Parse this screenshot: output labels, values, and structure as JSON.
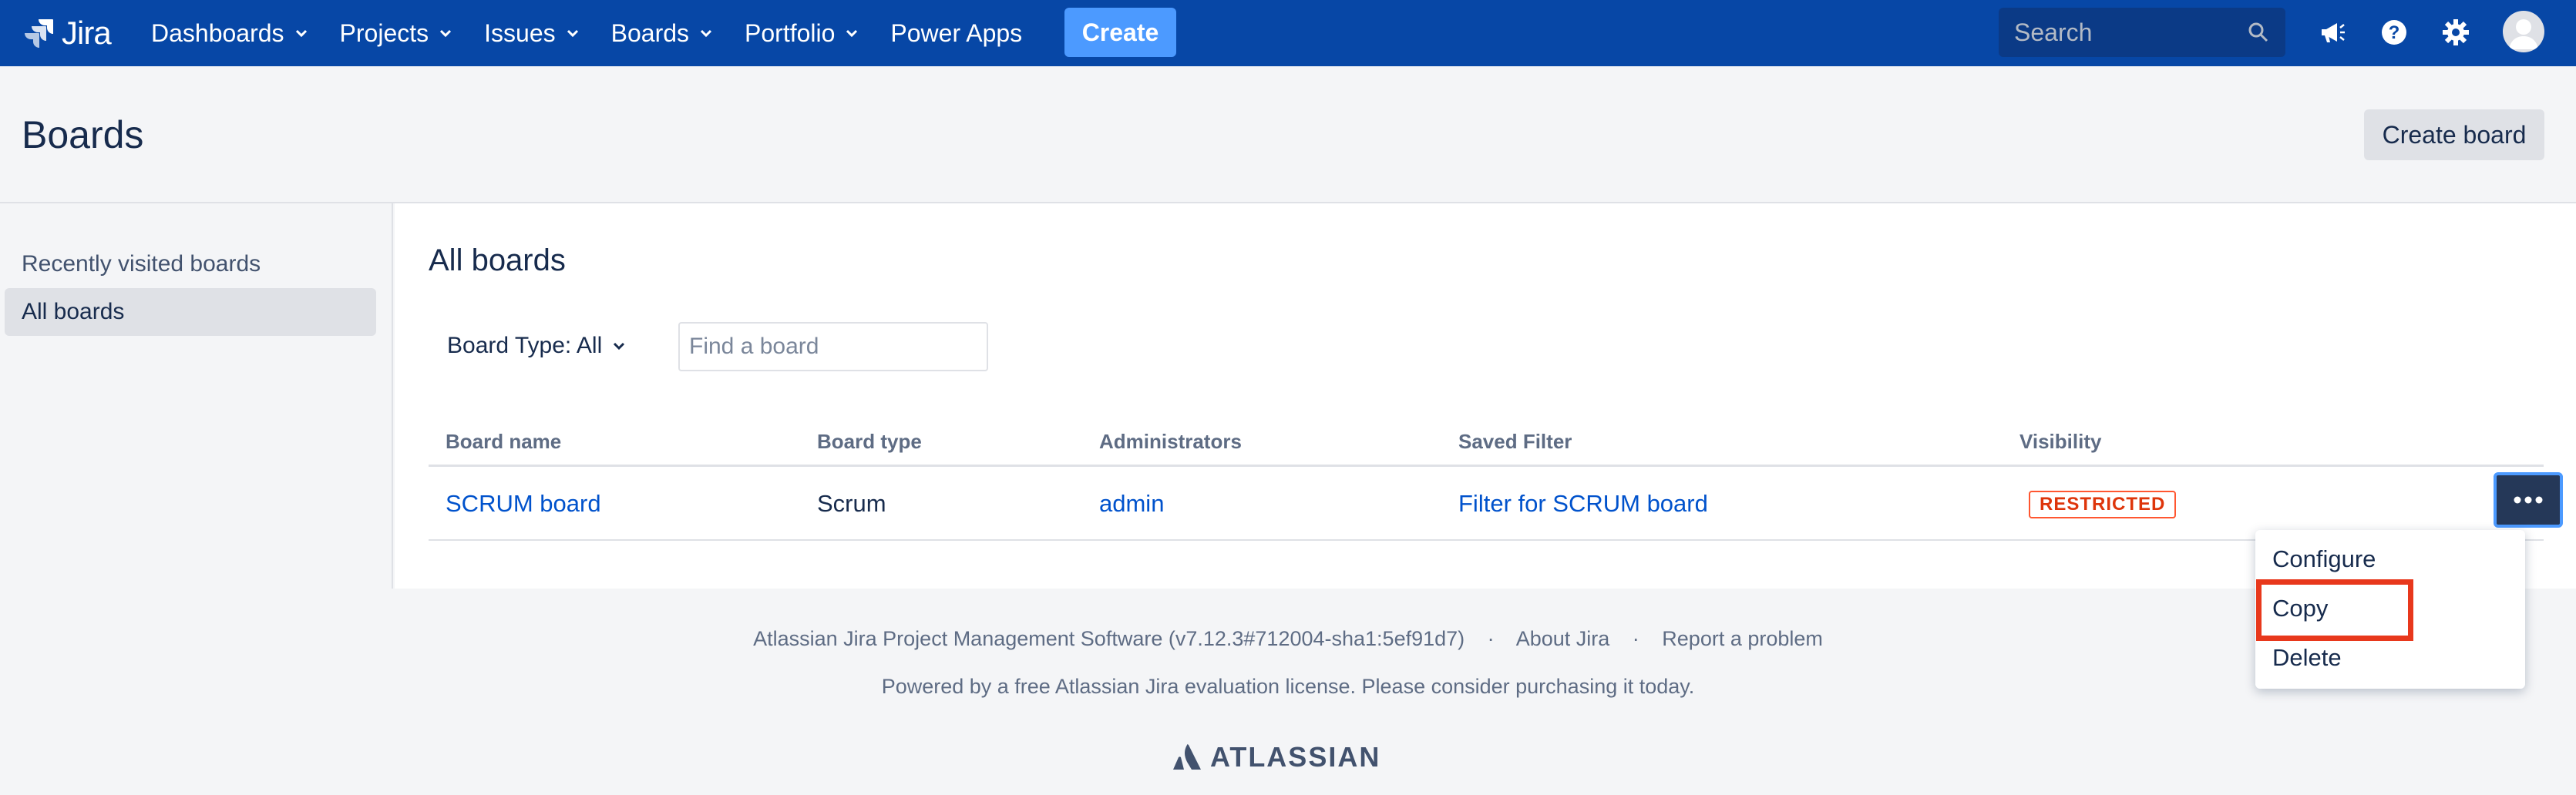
{
  "colors": {
    "nav_bg": "#0747a6",
    "create_bg": "#4c9aff",
    "link": "#0052cc",
    "restricted": "#de350b",
    "highlight": "#e8381c"
  },
  "nav": {
    "logo_text": "Jira",
    "items": [
      {
        "label": "Dashboards",
        "dropdown": true
      },
      {
        "label": "Projects",
        "dropdown": true
      },
      {
        "label": "Issues",
        "dropdown": true
      },
      {
        "label": "Boards",
        "dropdown": true
      },
      {
        "label": "Portfolio",
        "dropdown": true
      },
      {
        "label": "Power Apps",
        "dropdown": false
      }
    ],
    "create_label": "Create",
    "search_placeholder": "Search",
    "icons": [
      "megaphone-icon",
      "help-icon",
      "gear-icon",
      "avatar"
    ]
  },
  "header": {
    "title": "Boards",
    "create_board_label": "Create board"
  },
  "sidebar": {
    "items": [
      {
        "label": "Recently visited boards",
        "active": false
      },
      {
        "label": "All boards",
        "active": true
      }
    ]
  },
  "main": {
    "title": "All boards",
    "filter_label": "Board Type: All",
    "find_placeholder": "Find a board",
    "table": {
      "headers": [
        "Board name",
        "Board type",
        "Administrators",
        "Saved Filter",
        "Visibility"
      ],
      "rows": [
        {
          "name": "SCRUM board",
          "type": "Scrum",
          "admin": "admin",
          "filter": "Filter for SCRUM board",
          "visibility": "RESTRICTED"
        }
      ]
    }
  },
  "dropdown": {
    "items": [
      "Configure",
      "Copy",
      "Delete"
    ]
  },
  "footer": {
    "software": "Atlassian Jira Project Management Software (v7.12.3#712004-sha1:5ef91d7)",
    "sep": "·",
    "about": "About Jira",
    "report": "Report a problem",
    "license": "Powered by a free Atlassian Jira evaluation license. Please consider purchasing it today.",
    "brand": "ATLASSIAN"
  }
}
